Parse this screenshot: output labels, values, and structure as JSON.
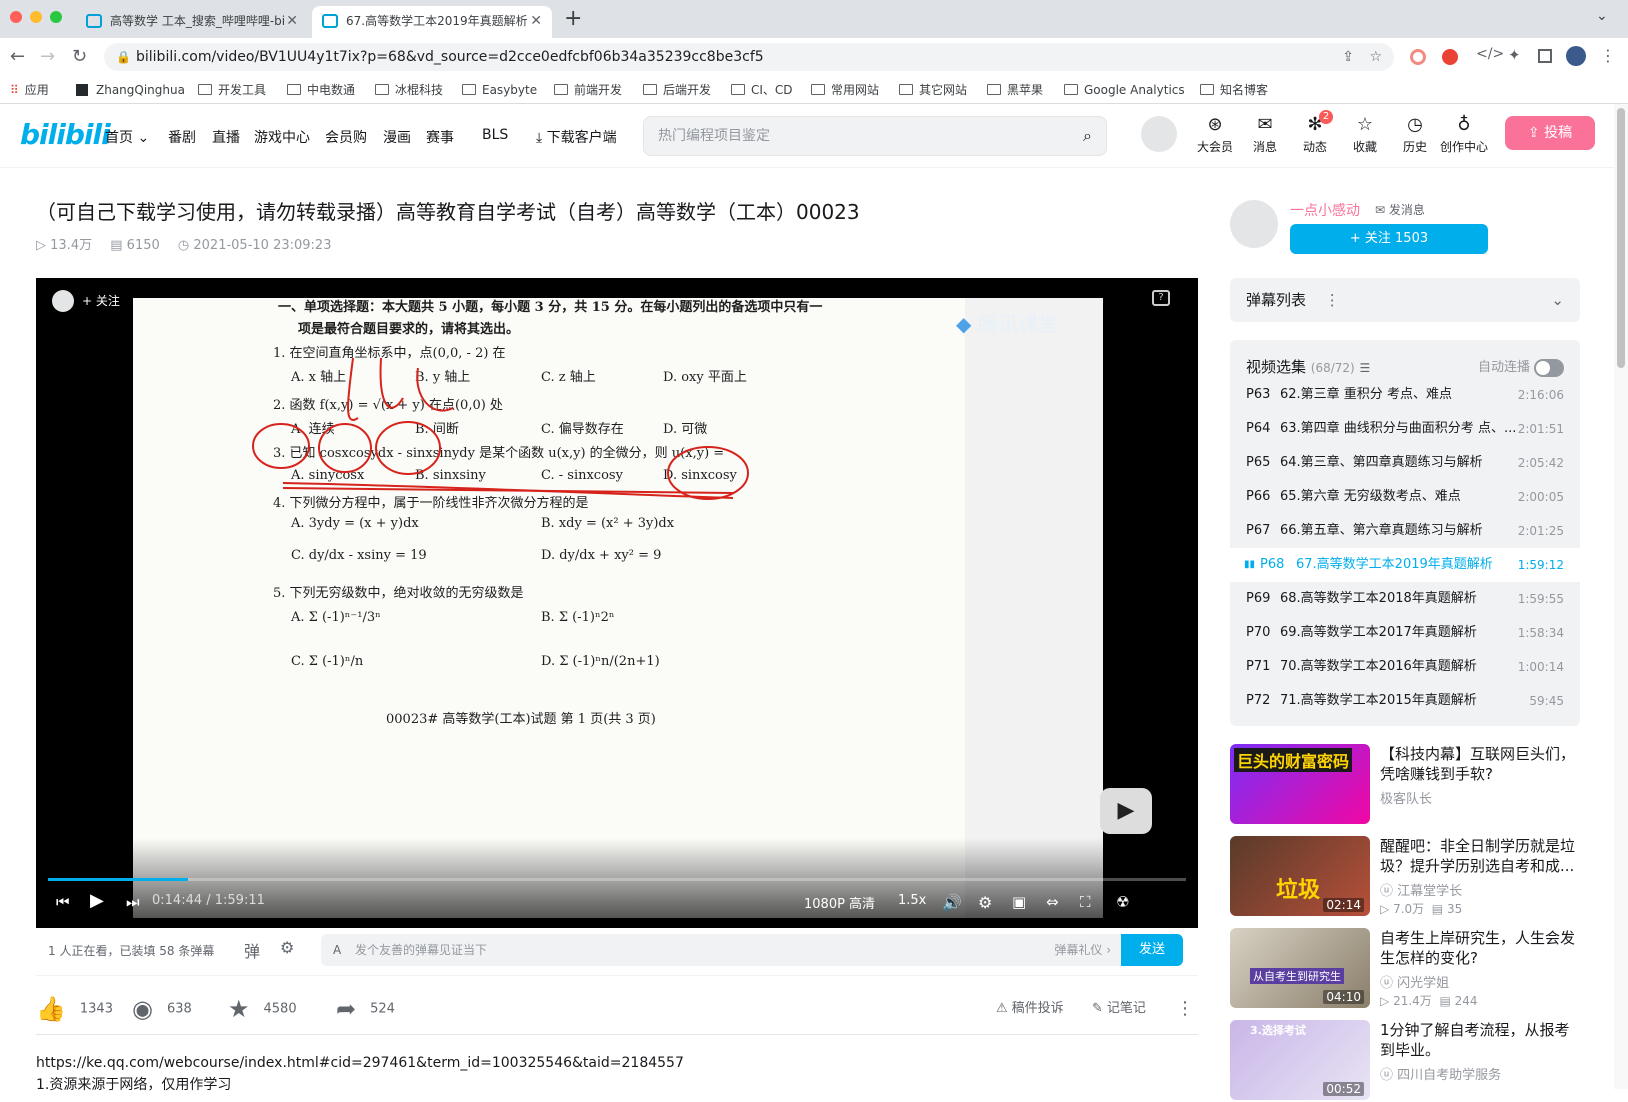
{
  "browser": {
    "tabs": [
      {
        "title": "高等数学 工本_搜索_哔哩哔哩-bi"
      },
      {
        "title": "67.高等数学工本2019年真题解析"
      }
    ],
    "url": "bilibili.com/video/BV1UU4y1t7ix?p=68&vd_source=d2cce0edfcbf06b34a35239cc8be3cf5",
    "bookmarks": [
      "应用",
      "ZhangQinghua",
      "开发工具",
      "中电数通",
      "冰棍科技",
      "Easybyte",
      "前端开发",
      "后端开发",
      "CI、CD",
      "常用网站",
      "其它网站",
      "黑苹果",
      "Google Analytics",
      "知名博客"
    ]
  },
  "header": {
    "logo": "bilibili",
    "nav": [
      "首页",
      "番剧",
      "直播",
      "游戏中心",
      "会员购",
      "漫画",
      "赛事",
      "BLS",
      "下载客户端"
    ],
    "search_placeholder": "热门编程项目鉴定",
    "right": [
      "大会员",
      "消息",
      "动态",
      "收藏",
      "历史",
      "创作中心"
    ],
    "badge": "2",
    "upload": "投稿"
  },
  "video": {
    "title": "（可自己下载学习使用，请勿转载录播）高等教育自学考试（自考）高等数学（工本）00023",
    "views": "13.4万",
    "danmaku": "6150",
    "date": "2021-05-10 23:09:23",
    "overlay_follow": "关注",
    "watermark": "腾讯课堂",
    "progress_fraction": 0.123,
    "time": "0:14:44 / 1:59:11",
    "quality": "1080P 高清",
    "speed": "1.5x"
  },
  "paper": {
    "lines": [
      "一、单项选择题：本大题共 5 小题，每小题 3 分，共 15 分。在每小题列出的备选项中只有一",
      "项是最符合题目要求的，请将其选出。",
      "1. 在空间直角坐标系中，点(0,0, - 2) 在",
      "A. x 轴上",
      "B. y 轴上",
      "C. z 轴上",
      "D. oxy 平面上",
      "2. 函数 f(x,y) = √(x + y) 在点(0,0) 处",
      "A. 连续",
      "B. 间断",
      "C. 偏导数存在",
      "D. 可微",
      "3. 已知 cosxcosydx - sinxsinydy 是某个函数 u(x,y) 的全微分，则 u(x,y) =",
      "A. sinycosx",
      "B. sinxsiny",
      "C. - sinxcosy",
      "D. sinxcosy",
      "4. 下列微分方程中，属于一阶线性非齐次微分方程的是",
      "A. 3ydy = (x + y)dx",
      "B. xdy = (x² + 3y)dx",
      "C. dy/dx - xsiny = 19",
      "D. dy/dx + xy² = 9",
      "5. 下列无穷级数中，绝对收敛的无穷级数是",
      "A. Σ (-1)ⁿ⁻¹/3ⁿ",
      "B. Σ (-1)ⁿ2ⁿ",
      "C. Σ (-1)ⁿ/n",
      "D. Σ (-1)ⁿn/(2n+1)",
      "00023# 高等数学(工本)试题 第 1 页(共 3 页)"
    ]
  },
  "danmaku_bar": {
    "status": "1 人正在看，已装填 58 条弹幕",
    "placeholder": "发个友善的弹幕见证当下",
    "etiquette": "弹幕礼仪 ›",
    "send": "发送"
  },
  "actions": {
    "like": "1343",
    "coin": "638",
    "fav": "4580",
    "share": "524",
    "report": "稿件投诉",
    "note": "记笔记"
  },
  "description": [
    "https://ke.qq.com/webcourse/index.html#cid=297461&term_id=100325546&taid=2184557",
    "1.资源来源于网络，仅用作学习"
  ],
  "uploader": {
    "name": "一点小感动",
    "message": "发消息",
    "follow": "+ 关注 1503"
  },
  "danmaku_list": "弹幕列表",
  "playlist": {
    "title": "视频选集",
    "count": "(68/72)",
    "autoplay": "自动连播",
    "items": [
      {
        "p": "P63",
        "title": "62.第三章 重积分 考点、难点",
        "dur": "2:16:06"
      },
      {
        "p": "P64",
        "title": "63.第四章 曲线积分与曲面积分考 点、...",
        "dur": "2:01:51"
      },
      {
        "p": "P65",
        "title": "64.第三章、第四章真题练习与解析",
        "dur": "2:05:42"
      },
      {
        "p": "P66",
        "title": "65.第六章 无穷级数考点、难点",
        "dur": "2:00:05"
      },
      {
        "p": "P67",
        "title": "66.第五章、第六章真题练习与解析",
        "dur": "2:01:25"
      },
      {
        "p": "P68",
        "title": "67.高等数学工本2019年真题解析",
        "dur": "1:59:12"
      },
      {
        "p": "P69",
        "title": "68.高等数学工本2018年真题解析",
        "dur": "1:59:55"
      },
      {
        "p": "P70",
        "title": "69.高等数学工本2017年真题解析",
        "dur": "1:58:34"
      },
      {
        "p": "P71",
        "title": "70.高等数学工本2016年真题解析",
        "dur": "1:00:14"
      },
      {
        "p": "P72",
        "title": "71.高等数学工本2015年真题解析",
        "dur": "59:45"
      }
    ]
  },
  "recommend": [
    {
      "title": "【科技内幕】互联网巨头们，凭啥赚钱到手软?",
      "author": "极客队长",
      "thumb_text": "巨头的财富密码",
      "dur": "",
      "views": "",
      "dm": ""
    },
    {
      "title": "醒醒吧：非全日制学历就是垃圾？提升学历别选自考和成...",
      "author": "江幕堂学长",
      "thumb_text": "垃圾",
      "dur": "02:14",
      "views": "7.0万",
      "dm": "35"
    },
    {
      "title": "自考生上岸研究生，人生会发生怎样的变化?",
      "author": "闪光学姐",
      "thumb_text": "从自考生到研究生",
      "dur": "04:10",
      "views": "21.4万",
      "dm": "244"
    },
    {
      "title": "1分钟了解自考流程，从报考到毕业。",
      "author": "四川自考助学服务",
      "thumb_text": "3.选择考试",
      "dur": "00:52",
      "views": "",
      "dm": ""
    }
  ]
}
